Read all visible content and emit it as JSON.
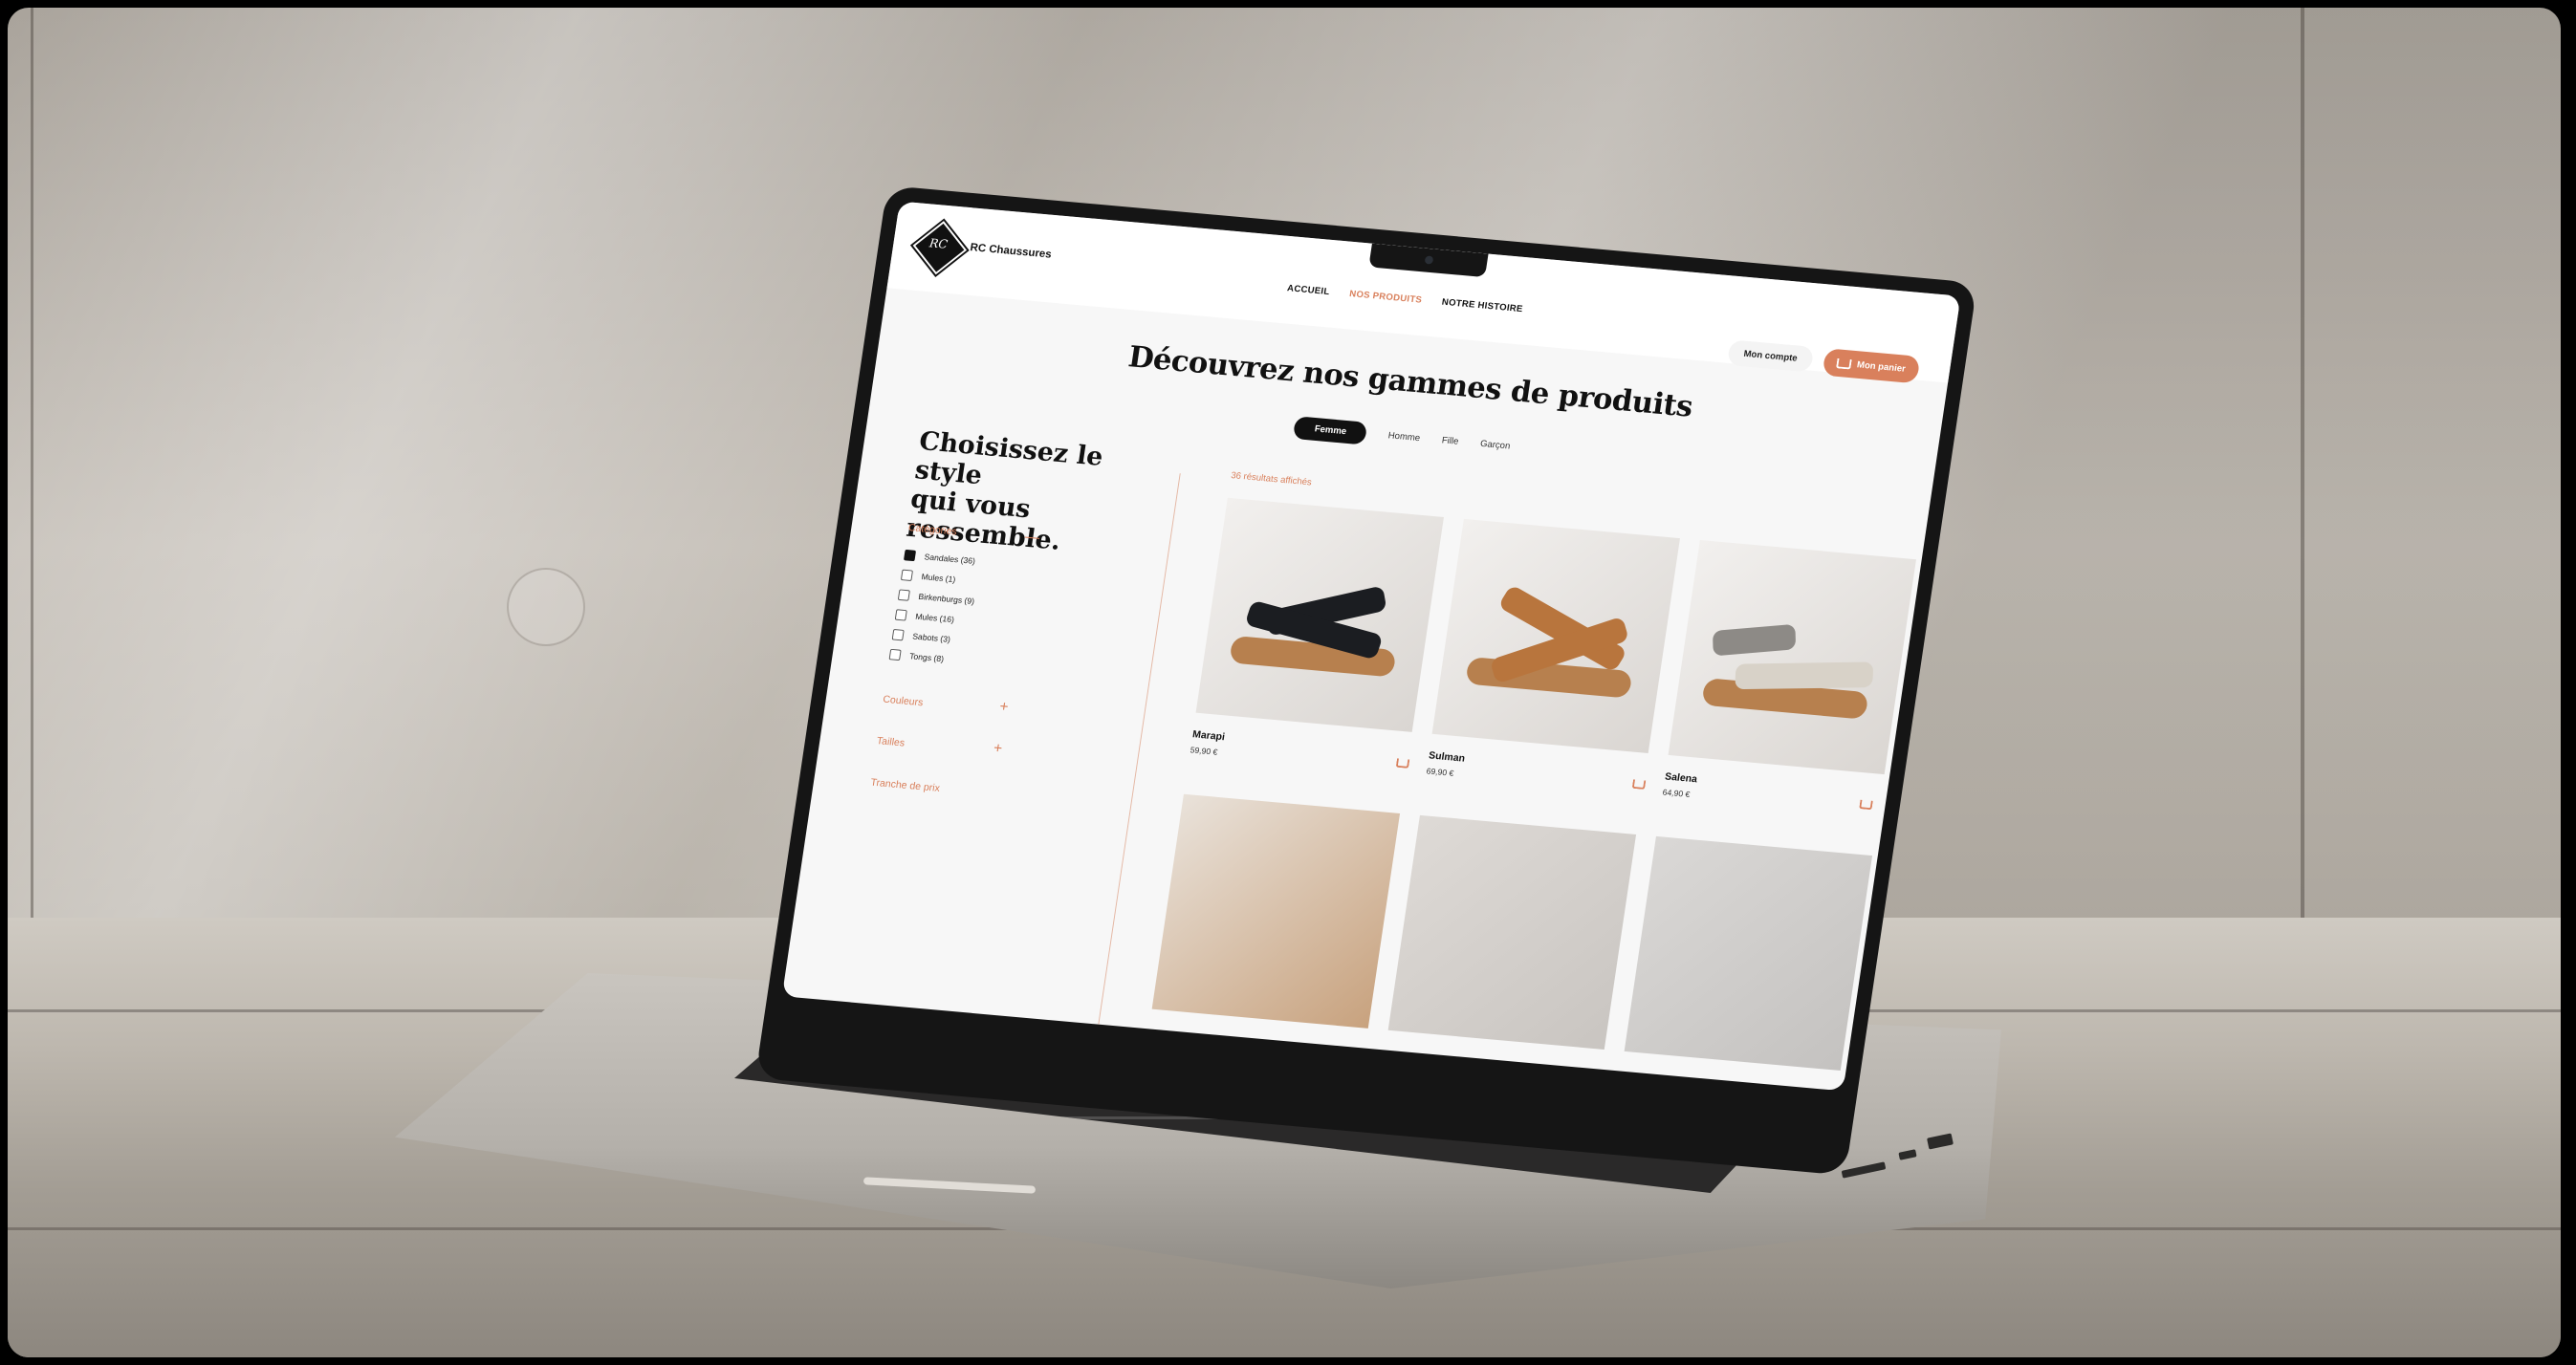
{
  "site": {
    "brand": "RC Chaussures",
    "logo_text": "RC",
    "nav": [
      "ACCUEIL",
      "NOS PRODUITS",
      "NOTRE HISTOIRE"
    ],
    "account_label": "Mon compte",
    "cart_label": "Mon panier"
  },
  "page": {
    "title": "Découvrez nos gammes de produits",
    "tabs": [
      "Femme",
      "Homme",
      "Fille",
      "Garçon"
    ],
    "active_tab": "Femme"
  },
  "sidebar": {
    "title_line1": "Choisissez le style",
    "title_line2": "qui vous ressemble.",
    "categories_label": "Catégories",
    "categories": [
      {
        "label": "Sandales (36)",
        "checked": true
      },
      {
        "label": "Mules (1)",
        "checked": false
      },
      {
        "label": "Birkenburgs (9)",
        "checked": false
      },
      {
        "label": "Mules (16)",
        "checked": false
      },
      {
        "label": "Sabots (3)",
        "checked": false
      },
      {
        "label": "Tongs (8)",
        "checked": false
      }
    ],
    "colors_label": "Couleurs",
    "sizes_label": "Tailles",
    "price_label": "Tranche de prix"
  },
  "results_text": "36 résultats affichés",
  "products": [
    {
      "name": "Marapi",
      "price": "59,90 €",
      "strap_color": "#1b1d21"
    },
    {
      "name": "Sulman",
      "price": "69,90 €",
      "strap_color": "#b8753d"
    },
    {
      "name": "Salena",
      "price": "64,90 €",
      "strap_color": "#d8d2c8"
    }
  ],
  "colors": {
    "accent": "#d9805c",
    "dark": "#111111"
  }
}
